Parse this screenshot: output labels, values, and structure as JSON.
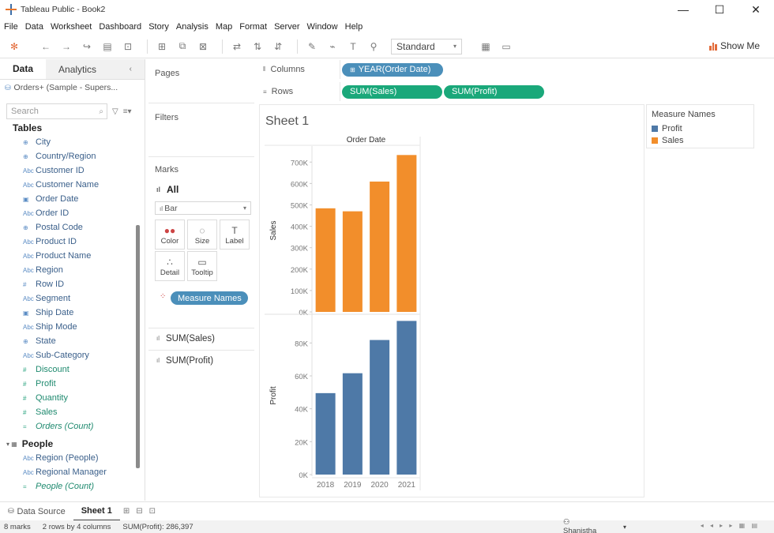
{
  "window": {
    "title": "Tableau Public - Book2",
    "minimize": "—",
    "maximize": "☐",
    "close": "✕"
  },
  "menu": [
    "File",
    "Data",
    "Worksheet",
    "Dashboard",
    "Story",
    "Analysis",
    "Map",
    "Format",
    "Server",
    "Window",
    "Help"
  ],
  "toolbar": {
    "fit_value": "Standard",
    "show_me_label": "Show Me"
  },
  "data_pane": {
    "tab_data": "Data",
    "tab_analytics": "Analytics",
    "datasource": "Orders+ (Sample - Supers...",
    "search_placeholder": "Search",
    "tables_header": "Tables",
    "fields": [
      {
        "label": "City",
        "icon": "⊕",
        "kind": "dimension"
      },
      {
        "label": "Country/Region",
        "icon": "⊕",
        "kind": "dimension"
      },
      {
        "label": "Customer ID",
        "icon": "Abc",
        "kind": "dimension"
      },
      {
        "label": "Customer Name",
        "icon": "Abc",
        "kind": "dimension"
      },
      {
        "label": "Order Date",
        "icon": "▣",
        "kind": "dimension"
      },
      {
        "label": "Order ID",
        "icon": "Abc",
        "kind": "dimension"
      },
      {
        "label": "Postal Code",
        "icon": "⊕",
        "kind": "dimension"
      },
      {
        "label": "Product ID",
        "icon": "Abc",
        "kind": "dimension"
      },
      {
        "label": "Product Name",
        "icon": "Abc",
        "kind": "dimension"
      },
      {
        "label": "Region",
        "icon": "Abc",
        "kind": "dimension"
      },
      {
        "label": "Row ID",
        "icon": "#",
        "kind": "dimension"
      },
      {
        "label": "Segment",
        "icon": "Abc",
        "kind": "dimension"
      },
      {
        "label": "Ship Date",
        "icon": "▣",
        "kind": "dimension"
      },
      {
        "label": "Ship Mode",
        "icon": "Abc",
        "kind": "dimension"
      },
      {
        "label": "State",
        "icon": "⊕",
        "kind": "dimension"
      },
      {
        "label": "Sub-Category",
        "icon": "Abc",
        "kind": "dimension"
      },
      {
        "label": "Discount",
        "icon": "#",
        "kind": "measure"
      },
      {
        "label": "Profit",
        "icon": "#",
        "kind": "measure"
      },
      {
        "label": "Quantity",
        "icon": "#",
        "kind": "measure"
      },
      {
        "label": "Sales",
        "icon": "#",
        "kind": "measure"
      },
      {
        "label": "Orders (Count)",
        "icon": "=",
        "kind": "measure",
        "italic": true
      }
    ],
    "people_header": "People",
    "people_fields": [
      {
        "label": "Region (People)",
        "icon": "Abc",
        "kind": "dimension"
      },
      {
        "label": "Regional Manager",
        "icon": "Abc",
        "kind": "dimension"
      },
      {
        "label": "People (Count)",
        "icon": "=",
        "kind": "measure",
        "italic": true
      }
    ]
  },
  "cards": {
    "pages": "Pages",
    "filters": "Filters",
    "marks": "Marks",
    "all": "All",
    "mark_type": "Bar",
    "buttons": [
      {
        "label": "Color",
        "icon": "●●"
      },
      {
        "label": "Size",
        "icon": "◌"
      },
      {
        "label": "Label",
        "icon": "T"
      },
      {
        "label": "Detail",
        "icon": "∴"
      },
      {
        "label": "Tooltip",
        "icon": "▭"
      }
    ],
    "color_pill": "Measure Names",
    "shelf_sales": "SUM(Sales)",
    "shelf_profit": "SUM(Profit)"
  },
  "shelves": {
    "columns_label": "Columns",
    "rows_label": "Rows",
    "columns_pill": "YEAR(Order Date)",
    "rows_pills": [
      "SUM(Sales)",
      "SUM(Profit)"
    ]
  },
  "view": {
    "sheet_title": "Sheet 1"
  },
  "legend": {
    "title": "Measure Names",
    "items": [
      {
        "label": "Profit",
        "color": "#4e79a7"
      },
      {
        "label": "Sales",
        "color": "#f28e2b"
      }
    ]
  },
  "chart_data": {
    "type": "bar",
    "title": "Order Date",
    "categories": [
      "2018",
      "2019",
      "2020",
      "2021"
    ],
    "panels": [
      {
        "name": "Sales",
        "ylabel": "Sales",
        "values": [
          484000,
          470000,
          609000,
          733000
        ],
        "ylim": [
          0,
          760000
        ],
        "ticks": [
          0,
          100000,
          200000,
          300000,
          400000,
          500000,
          600000,
          700000
        ],
        "tick_labels": [
          "0K",
          "100K",
          "200K",
          "300K",
          "400K",
          "500K",
          "600K",
          "700K"
        ],
        "color": "#f28e2b"
      },
      {
        "name": "Profit",
        "ylabel": "Profit",
        "values": [
          49500,
          61600,
          81800,
          93400
        ],
        "ylim": [
          0,
          96000
        ],
        "ticks": [
          0,
          20000,
          40000,
          60000,
          80000
        ],
        "tick_labels": [
          "0K",
          "20K",
          "40K",
          "60K",
          "80K"
        ],
        "color": "#4e79a7"
      }
    ]
  },
  "tabs": {
    "data_source": "Data Source",
    "sheet1": "Sheet 1"
  },
  "status": {
    "marks": "8 marks",
    "dims": "2 rows by 4 columns",
    "sum": "SUM(Profit): 286,397",
    "user": "Shanistha"
  }
}
